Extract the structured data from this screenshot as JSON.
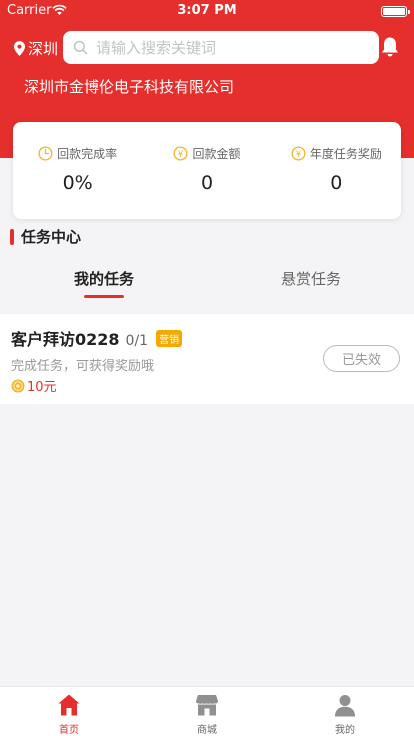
{
  "status_bar": {
    "carrier": "Carrier",
    "time": "3:07 PM"
  },
  "header": {
    "location": "深圳",
    "search_placeholder": "请输入搜索关键词",
    "company": "深圳市金博伦电子科技有限公司"
  },
  "stats": [
    {
      "label": "回款完成率",
      "value": "0%",
      "icon": "clock-icon"
    },
    {
      "label": "回款金额",
      "value": "0",
      "icon": "yen-icon"
    },
    {
      "label": "年度任务奖励",
      "value": "0",
      "icon": "yen-icon"
    }
  ],
  "section_title": "任务中心",
  "tabs": [
    {
      "label": "我的任务",
      "active": true
    },
    {
      "label": "悬赏任务",
      "active": false
    }
  ],
  "task": {
    "title": "客户拜访0228",
    "progress": "0/1",
    "tag": "营销",
    "description": "完成任务，可获得奖励哦",
    "reward": "10元",
    "status_button": "已失效"
  },
  "tabbar": [
    {
      "label": "首页",
      "icon": "home-icon",
      "active": true
    },
    {
      "label": "商城",
      "icon": "shop-icon",
      "active": false
    },
    {
      "label": "我的",
      "icon": "user-icon",
      "active": false
    }
  ],
  "colors": {
    "brand": "#e42f2c",
    "accent": "#f4a800",
    "icon_yellow": "#f2b531"
  }
}
